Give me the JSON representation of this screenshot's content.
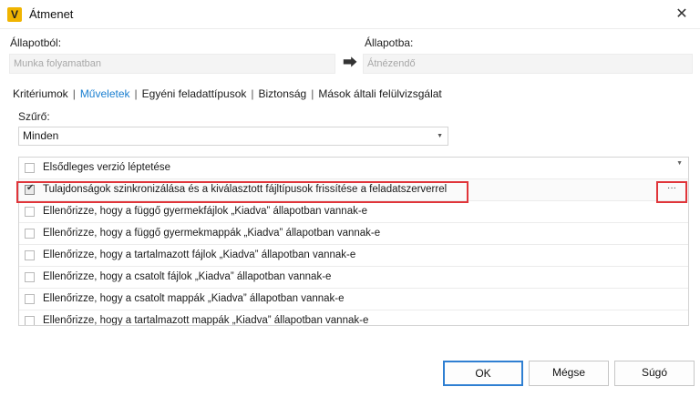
{
  "window": {
    "title": "Átmenet",
    "icon": "app-logo-icon",
    "icon_glyph": "V",
    "close_glyph": "✕"
  },
  "from": {
    "label": "Állapotból:",
    "value": "Munka folyamatban"
  },
  "to": {
    "label": "Állapotba:",
    "value": "Átnézendő"
  },
  "arrow_glyph": "⮕",
  "tabs": [
    {
      "label": "Kritériumok",
      "active": false
    },
    {
      "label": "Műveletek",
      "active": true
    },
    {
      "label": "Egyéni feladattípusok",
      "active": false
    },
    {
      "label": "Biztonság",
      "active": false
    },
    {
      "label": "Mások általi felülvizsgálat",
      "active": false
    }
  ],
  "tab_separator": "|",
  "filter": {
    "label": "Szűrő:",
    "value": "Minden",
    "caret": "▼"
  },
  "actions": [
    {
      "label": "Elsődleges verzió léptetése",
      "checked": false
    },
    {
      "label": "Tulajdonságok szinkronizálása és a kiválasztott fájltípusok frissítése a feladatszerverrel",
      "checked": true
    },
    {
      "label": "Ellenőrizze, hogy a függő gyermekfájlok „Kiadva” állapotban vannak-e",
      "checked": false
    },
    {
      "label": "Ellenőrizze, hogy a függő gyermekmappák „Kiadva” állapotban vannak-e",
      "checked": false
    },
    {
      "label": "Ellenőrizze, hogy a tartalmazott fájlok „Kiadva” állapotban vannak-e",
      "checked": false
    },
    {
      "label": "Ellenőrizze, hogy a csatolt fájlok „Kiadva” állapotban vannak-e",
      "checked": false
    },
    {
      "label": "Ellenőrizze, hogy a csatolt mappák „Kiadva” állapotban vannak-e",
      "checked": false
    },
    {
      "label": "Ellenőrizze, hogy a tartalmazott mappák „Kiadva” állapotban vannak-e",
      "checked": false
    }
  ],
  "row_more": "···",
  "row_caret": "▼",
  "buttons": {
    "ok": "OK",
    "cancel": "Mégse",
    "help": "Súgó"
  },
  "colors": {
    "accent": "#1a7fd0",
    "highlight": "#e0353a",
    "primary_border": "#2f7fd2"
  }
}
